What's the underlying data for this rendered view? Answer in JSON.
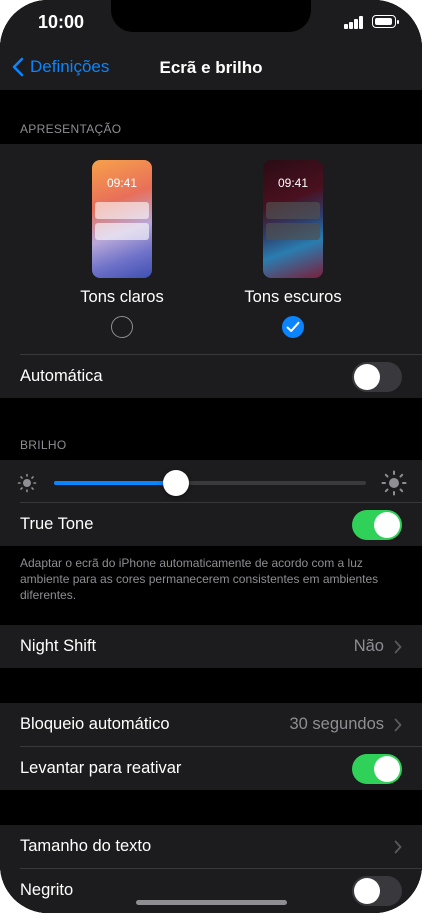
{
  "status": {
    "time": "10:00"
  },
  "nav": {
    "back_label": "Definições",
    "title": "Ecrã e brilho"
  },
  "appearance": {
    "header": "APRESENTAÇÃO",
    "light": {
      "label": "Tons claros",
      "clock": "09:41",
      "selected": false
    },
    "dark": {
      "label": "Tons escuros",
      "clock": "09:41",
      "selected": true
    },
    "automatic": {
      "label": "Automática",
      "on": false
    }
  },
  "brightness": {
    "header": "BRILHO",
    "level_fraction": 0.39,
    "true_tone": {
      "label": "True Tone",
      "on": true
    },
    "footer": "Adaptar o ecrã do iPhone automaticamente de acordo com a luz ambiente para as cores permanecerem consistentes em ambientes diferentes."
  },
  "night_shift": {
    "label": "Night Shift",
    "value": "Não"
  },
  "auto_lock": {
    "label": "Bloqueio automático",
    "value": "30 segundos"
  },
  "raise_to_wake": {
    "label": "Levantar para reativar",
    "on": true
  },
  "text_size": {
    "label": "Tamanho do texto"
  },
  "bold": {
    "label": "Negrito",
    "on": false
  },
  "colors": {
    "accent": "#0a84ff",
    "toggle_on": "#30d158",
    "background": "#000000",
    "cell": "#1c1c1e"
  }
}
